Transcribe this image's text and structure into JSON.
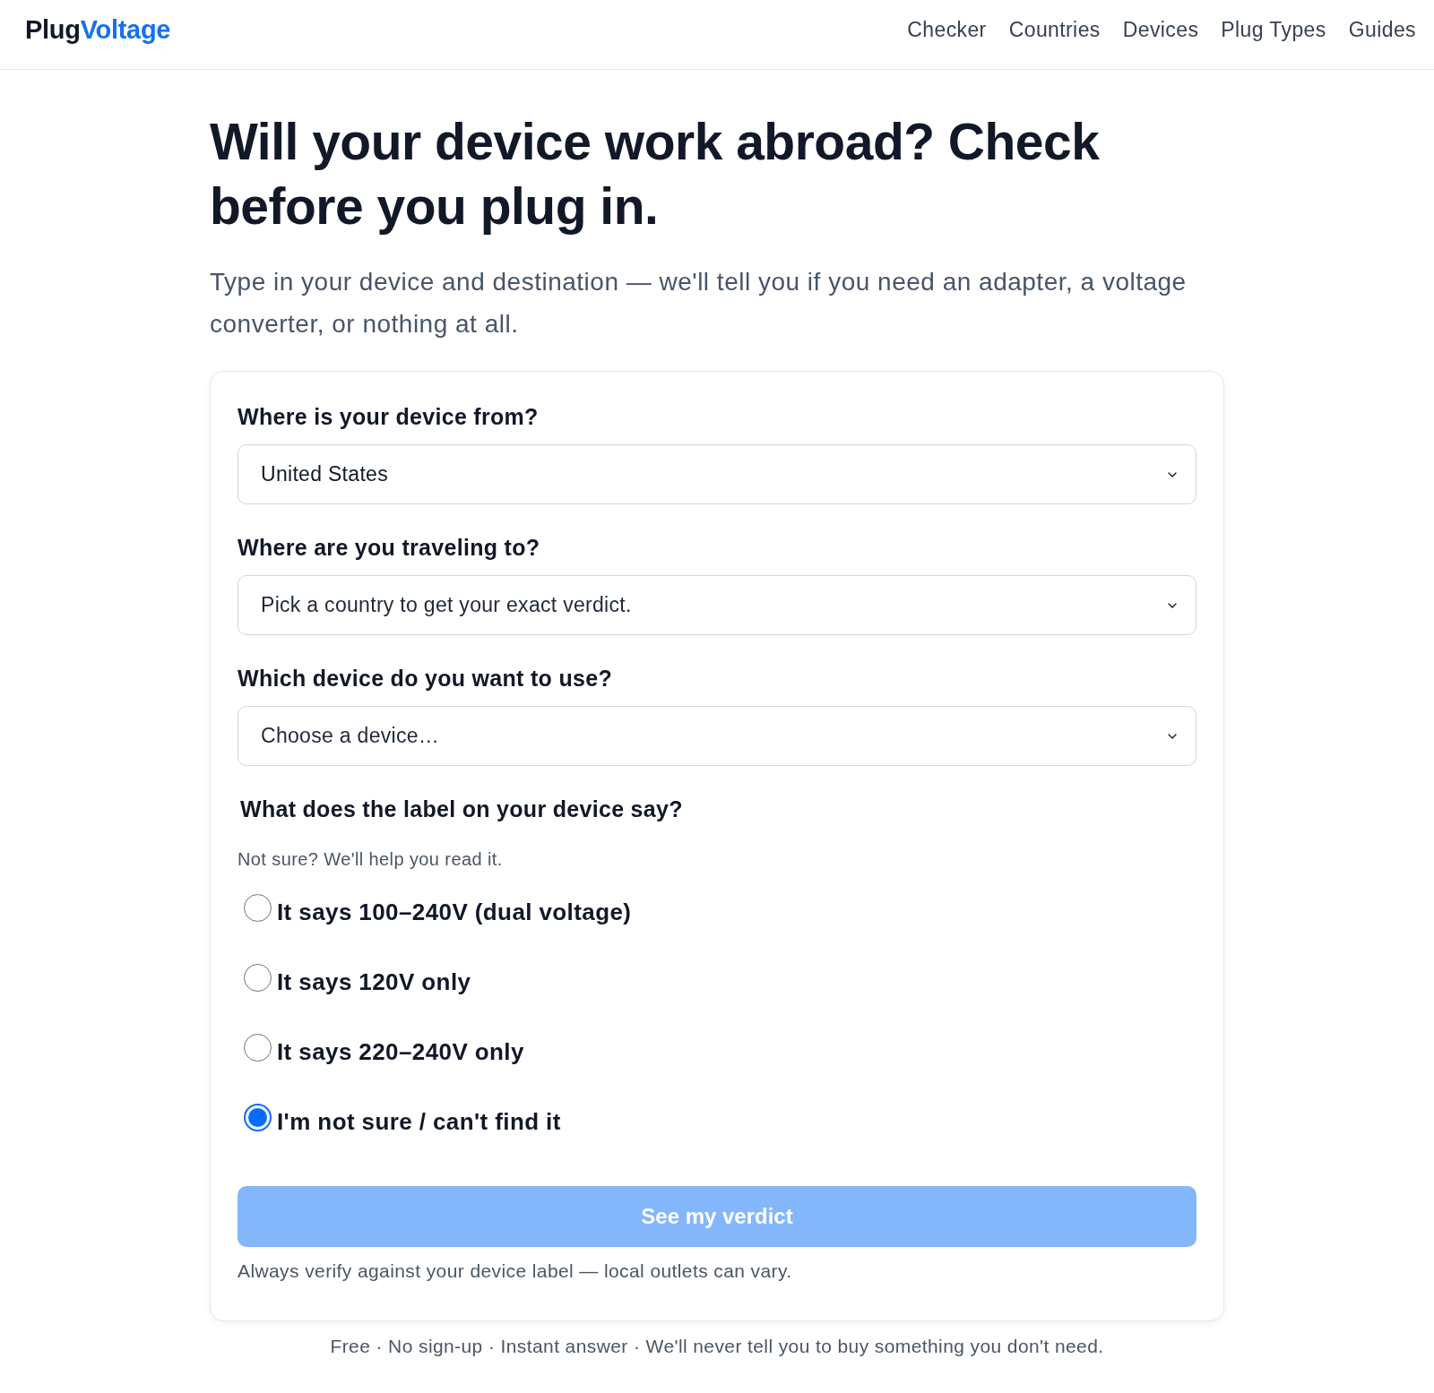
{
  "header": {
    "logo": {
      "first": "Plug",
      "second": "Voltage"
    },
    "nav": [
      "Checker",
      "Countries",
      "Devices",
      "Plug Types",
      "Guides"
    ]
  },
  "hero": {
    "title": "Will your device work abroad? Check before you plug in.",
    "subtitle": "Type in your device and destination — we'll tell you if you need an adapter, a voltage converter, or nothing at all."
  },
  "form": {
    "fields": [
      {
        "label": "Where is your device from?",
        "value": "United States"
      },
      {
        "label": "Where are you traveling to?",
        "placeholder": "Pick a country to get your exact verdict."
      },
      {
        "label": "Which device do you want to use?",
        "placeholder": "Choose a device…"
      }
    ],
    "question": {
      "label": "What does the label on your device say?",
      "hint": "Not sure? We'll help you read it.",
      "options": [
        {
          "label": "It says 100–240V (dual voltage)",
          "selected": false
        },
        {
          "label": "It says 120V only",
          "selected": false
        },
        {
          "label": "It says 220–240V only",
          "selected": false
        },
        {
          "label": "I'm not sure / can't find it",
          "selected": true
        }
      ]
    },
    "submit": {
      "label": "See my verdict",
      "disabled": true
    },
    "note": "Always verify against your device label — local outlets can vary."
  },
  "footer": "Free · No sign-up · Instant answer · We'll never tell you to buy something you don't need."
}
